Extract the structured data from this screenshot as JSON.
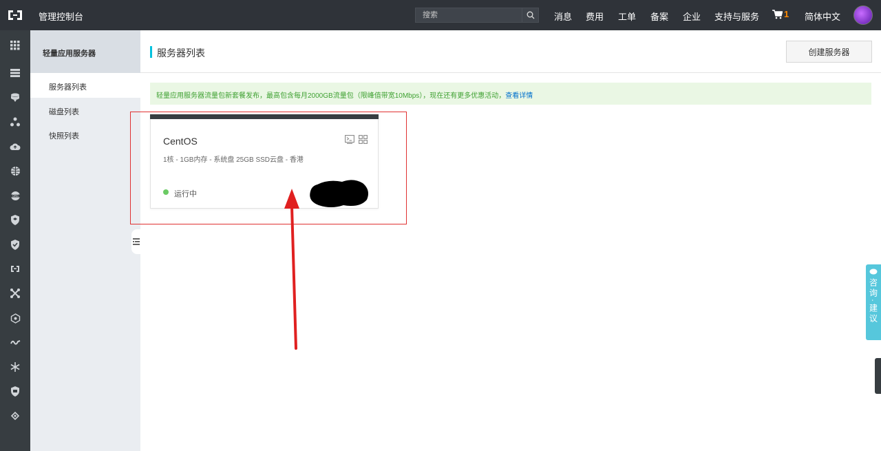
{
  "topbar": {
    "app_title": "管理控制台",
    "search_placeholder": "搜索",
    "nav": [
      "消息",
      "费用",
      "工单",
      "备案",
      "企业",
      "支持与服务"
    ],
    "cart_count": "1",
    "language": "简体中文"
  },
  "rail": {
    "icons": [
      "grid-icon",
      "server-list-icon",
      "database-icon",
      "network-icon",
      "cloud-icon",
      "globe-icon",
      "dns-icon",
      "shield-icon",
      "shield-check-icon",
      "cdn-icon",
      "connect-icon",
      "cluster-icon",
      "wave-icon",
      "snowflake-icon",
      "security-badge-icon",
      "tag-icon"
    ]
  },
  "sidebar": {
    "header": "轻量应用服务器",
    "items": [
      {
        "label": "服务器列表",
        "active": true
      },
      {
        "label": "磁盘列表",
        "active": false
      },
      {
        "label": "快照列表",
        "active": false
      }
    ]
  },
  "main": {
    "page_title": "服务器列表",
    "create_button": "创建服务器",
    "notice_text": "轻量应用服务器流量包新套餐发布，最高包含每月2000GB流量包（限峰值带宽10Mbps），现在还有更多优惠活动，",
    "notice_link": "查看详情"
  },
  "server_card": {
    "os": "CentOS",
    "spec": "1核 - 1GB内存 - 系统盘 25GB SSD云盘 - 香港",
    "status": "运行中",
    "status_color": "#6bcb64"
  },
  "feedback": {
    "label": "咨询·建议"
  },
  "colors": {
    "topbar": "#2f3339",
    "accent": "#00c1de",
    "annotation": "#e03030"
  }
}
